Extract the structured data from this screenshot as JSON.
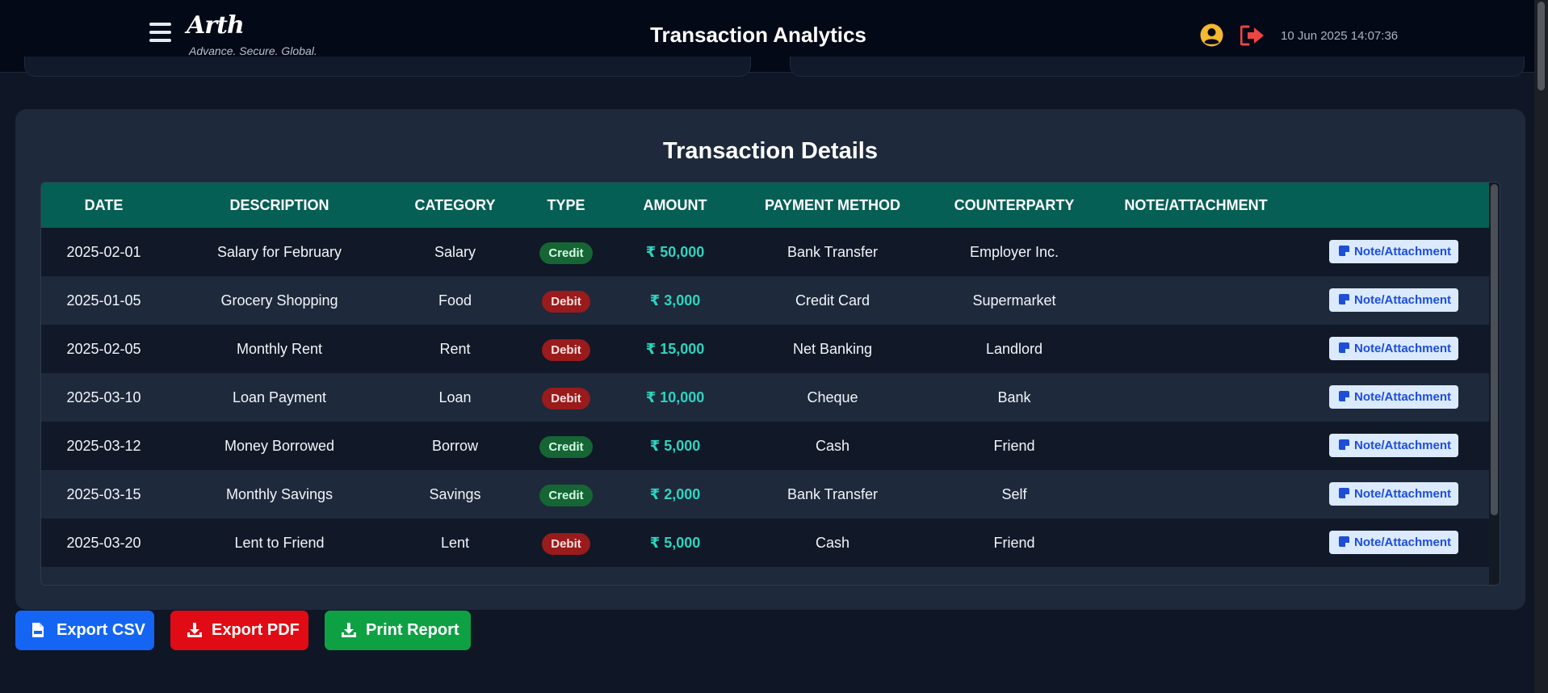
{
  "header": {
    "logo": "Arth",
    "tagline": "Advance. Secure. Global.",
    "title": "Transaction Analytics",
    "datetime": "10 Jun 2025 14:07:36",
    "icons": [
      "menu-icon",
      "user-icon",
      "logout-icon"
    ]
  },
  "panel": {
    "title": "Transaction Details"
  },
  "table": {
    "columns": [
      "DATE",
      "DESCRIPTION",
      "CATEGORY",
      "TYPE",
      "AMOUNT",
      "PAYMENT METHOD",
      "COUNTERPARTY",
      "NOTE/ATTACHMENT"
    ],
    "note_button_label": "Note/Attachment",
    "rows": [
      {
        "date": "2025-02-01",
        "description": "Salary for February",
        "category": "Salary",
        "type": "Credit",
        "amount": "₹ 50,000",
        "method": "Bank Transfer",
        "counterparty": "Employer Inc."
      },
      {
        "date": "2025-01-05",
        "description": "Grocery Shopping",
        "category": "Food",
        "type": "Debit",
        "amount": "₹ 3,000",
        "method": "Credit Card",
        "counterparty": "Supermarket"
      },
      {
        "date": "2025-02-05",
        "description": "Monthly Rent",
        "category": "Rent",
        "type": "Debit",
        "amount": "₹ 15,000",
        "method": "Net Banking",
        "counterparty": "Landlord"
      },
      {
        "date": "2025-03-10",
        "description": "Loan Payment",
        "category": "Loan",
        "type": "Debit",
        "amount": "₹ 10,000",
        "method": "Cheque",
        "counterparty": "Bank"
      },
      {
        "date": "2025-03-12",
        "description": "Money Borrowed",
        "category": "Borrow",
        "type": "Credit",
        "amount": "₹ 5,000",
        "method": "Cash",
        "counterparty": "Friend"
      },
      {
        "date": "2025-03-15",
        "description": "Monthly Savings",
        "category": "Savings",
        "type": "Credit",
        "amount": "₹ 2,000",
        "method": "Bank Transfer",
        "counterparty": "Self"
      },
      {
        "date": "2025-03-20",
        "description": "Lent to Friend",
        "category": "Lent",
        "type": "Debit",
        "amount": "₹ 5,000",
        "method": "Cash",
        "counterparty": "Friend"
      }
    ]
  },
  "actions": {
    "export_csv": "Export CSV",
    "export_pdf": "Export PDF",
    "print_report": "Print Report"
  },
  "colors": {
    "background": "#0f1626",
    "header": "#040917",
    "panel": "#1e293b",
    "table_header": "#065f55",
    "amount": "#2dd4bf",
    "credit": "#166534",
    "debit": "#991b1b",
    "csv_button": "#1565f5",
    "pdf_button": "#e00b14",
    "print_button": "#0ea144"
  }
}
